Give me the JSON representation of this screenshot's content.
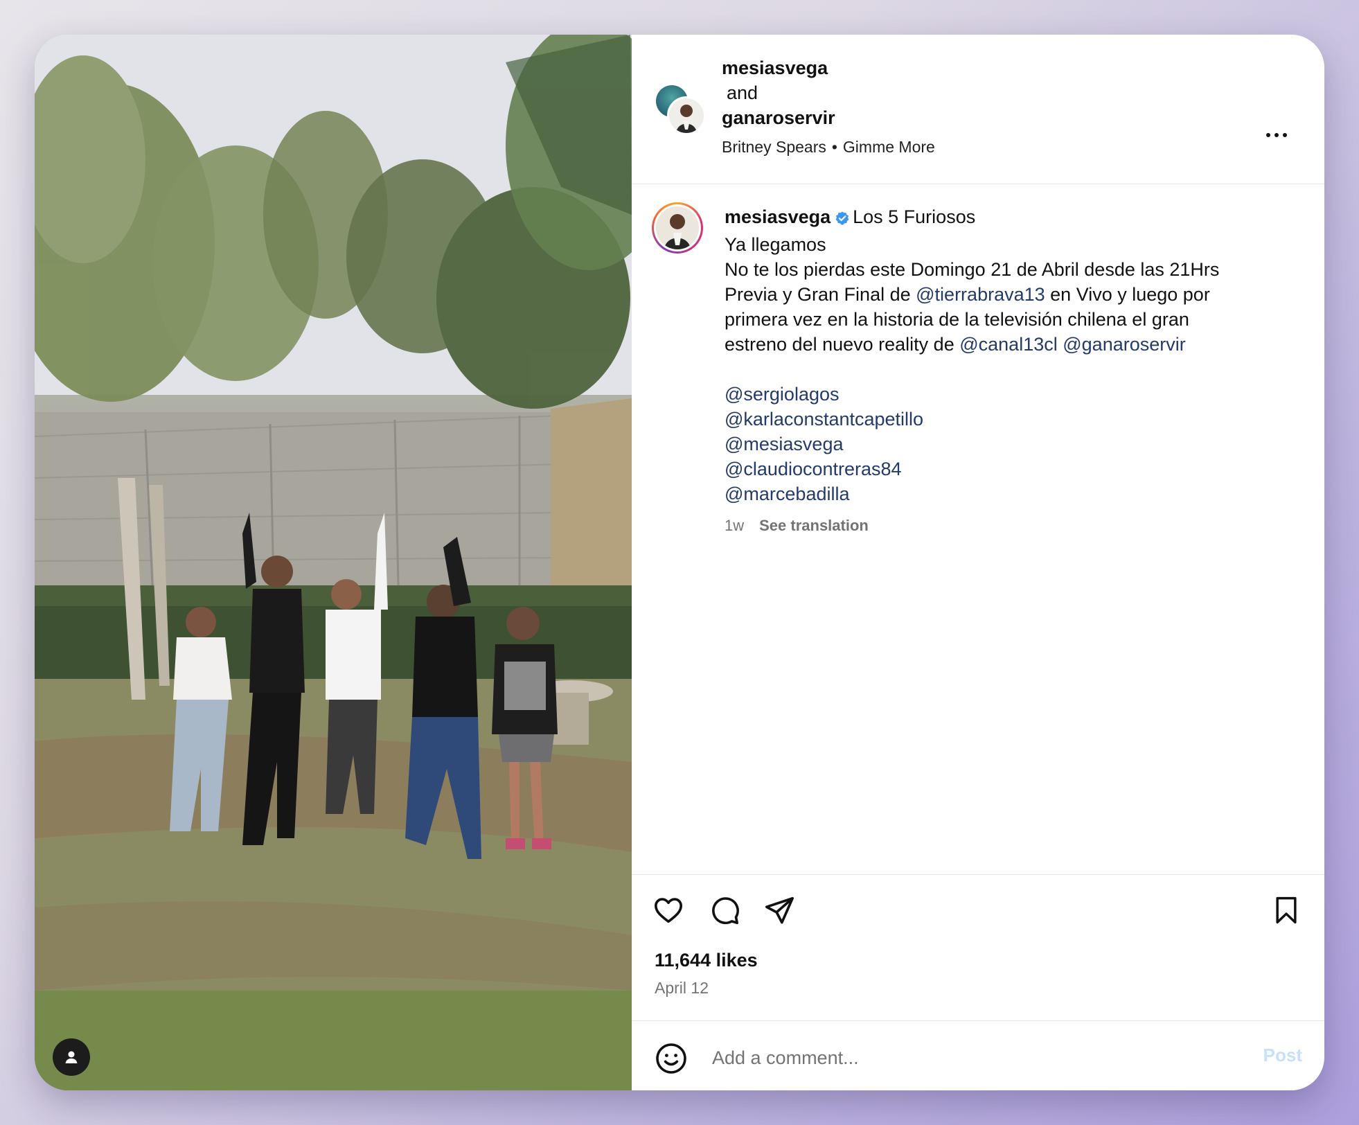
{
  "post": {
    "header": {
      "author": "mesiasvega",
      "joiner": "and",
      "collaborator": "ganaroservir",
      "music_artist": "Britney Spears",
      "music_separator": "•",
      "music_track": "Gimme More",
      "more_icon": "more-horizontal-icon"
    },
    "caption": {
      "username": "mesiasvega",
      "verified_icon": "verified-badge-icon",
      "title": "Los 5 Furiosos",
      "line1": "Ya llegamos",
      "line2": "No te los pierdas este Domingo 21 de Abril desde las 21Hrs",
      "line3_pre": "Previa y Gran Final de",
      "line3_mention": "@tierrabrava13",
      "line3_post": "en Vivo y luego por",
      "line4": "primera vez en la historia de la televisión chilena el gran",
      "line5_pre": "estreno del nuevo reality de",
      "line5_mention1": "@canal13cl",
      "line5_mention2": "@ganaroservir",
      "mentions": [
        "@sergiolagos",
        "@karlaconstantcapetillo",
        "@mesiasvega",
        "@claudiocontreras84",
        "@marcebadilla"
      ],
      "age": "1w",
      "translate_label": "See translation"
    },
    "actions": {
      "like_icon": "heart-icon",
      "comment_icon": "comment-icon",
      "share_icon": "paper-plane-icon",
      "save_icon": "bookmark-icon"
    },
    "likes_text": "11,644 likes",
    "date_text": "April 12",
    "comment": {
      "emoji_icon": "emoji-icon",
      "placeholder": "Add a comment...",
      "value": "",
      "post_label": "Post",
      "post_color": "#c7e0fb"
    },
    "media": {
      "user_tag_icon": "user-tag-icon"
    }
  },
  "colors": {
    "mention": "#233a6a",
    "verified": "#3897f0",
    "muted": "#737373"
  }
}
